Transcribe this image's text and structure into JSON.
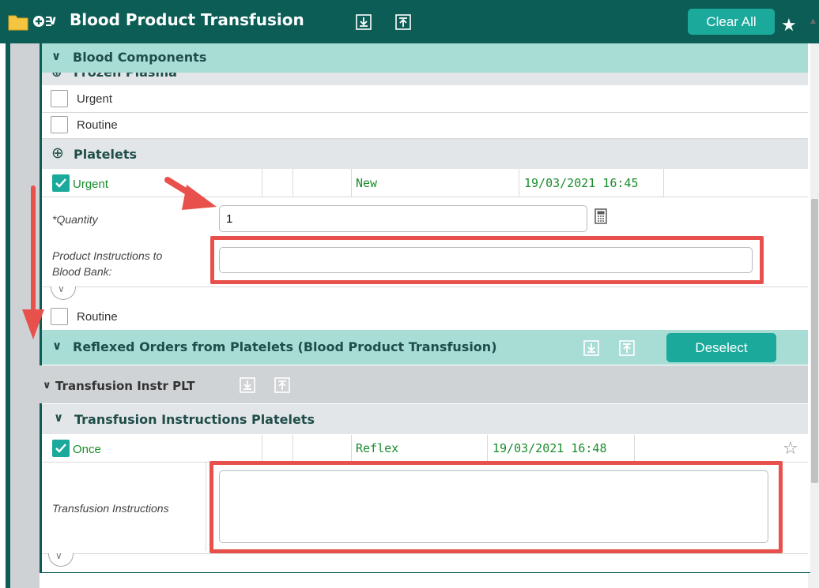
{
  "header": {
    "title": "Blood Product Transfusion",
    "clear_all_label": "Clear All"
  },
  "blood_components": {
    "title": "Blood Components",
    "cut_label": "Frozen Plasma",
    "ffp_options": [
      "Urgent",
      "Routine"
    ],
    "platelets_title": "Platelets",
    "order_row": {
      "label": "Urgent",
      "status": "New",
      "datetime": "19/03/2021 16:45"
    },
    "quantity_label": "*Quantity",
    "quantity_value": "1",
    "product_instructions_label_1": "Product Instructions to",
    "product_instructions_label_2": "Blood Bank:",
    "product_instructions_value": "",
    "routine_label": "Routine"
  },
  "reflexed": {
    "title": "Reflexed Orders from Platelets (Blood Product Transfusion)",
    "deselect_label": "Deselect",
    "sub_title": "Transfusion Instr PLT",
    "group_title": "Transfusion Instructions Platelets",
    "order_row": {
      "label": "Once",
      "status": "Reflex",
      "datetime": "19/03/2021 16:48"
    },
    "instructions_label": "Transfusion Instructions",
    "instructions_value": ""
  },
  "colors": {
    "header_bg": "#0b5d56",
    "accent": "#1aa99b",
    "section_bg": "#a8ddd6",
    "highlight": "#e8514b",
    "status_text": "#1a8c2c"
  },
  "icons": [
    "folder-icon",
    "add-list-icon",
    "chevron-down-icon",
    "expand-all-icon",
    "collapse-all-icon",
    "star-icon",
    "add-circle-icon",
    "checkbox-icon",
    "calculator-icon",
    "arrow-annotation-icon"
  ]
}
